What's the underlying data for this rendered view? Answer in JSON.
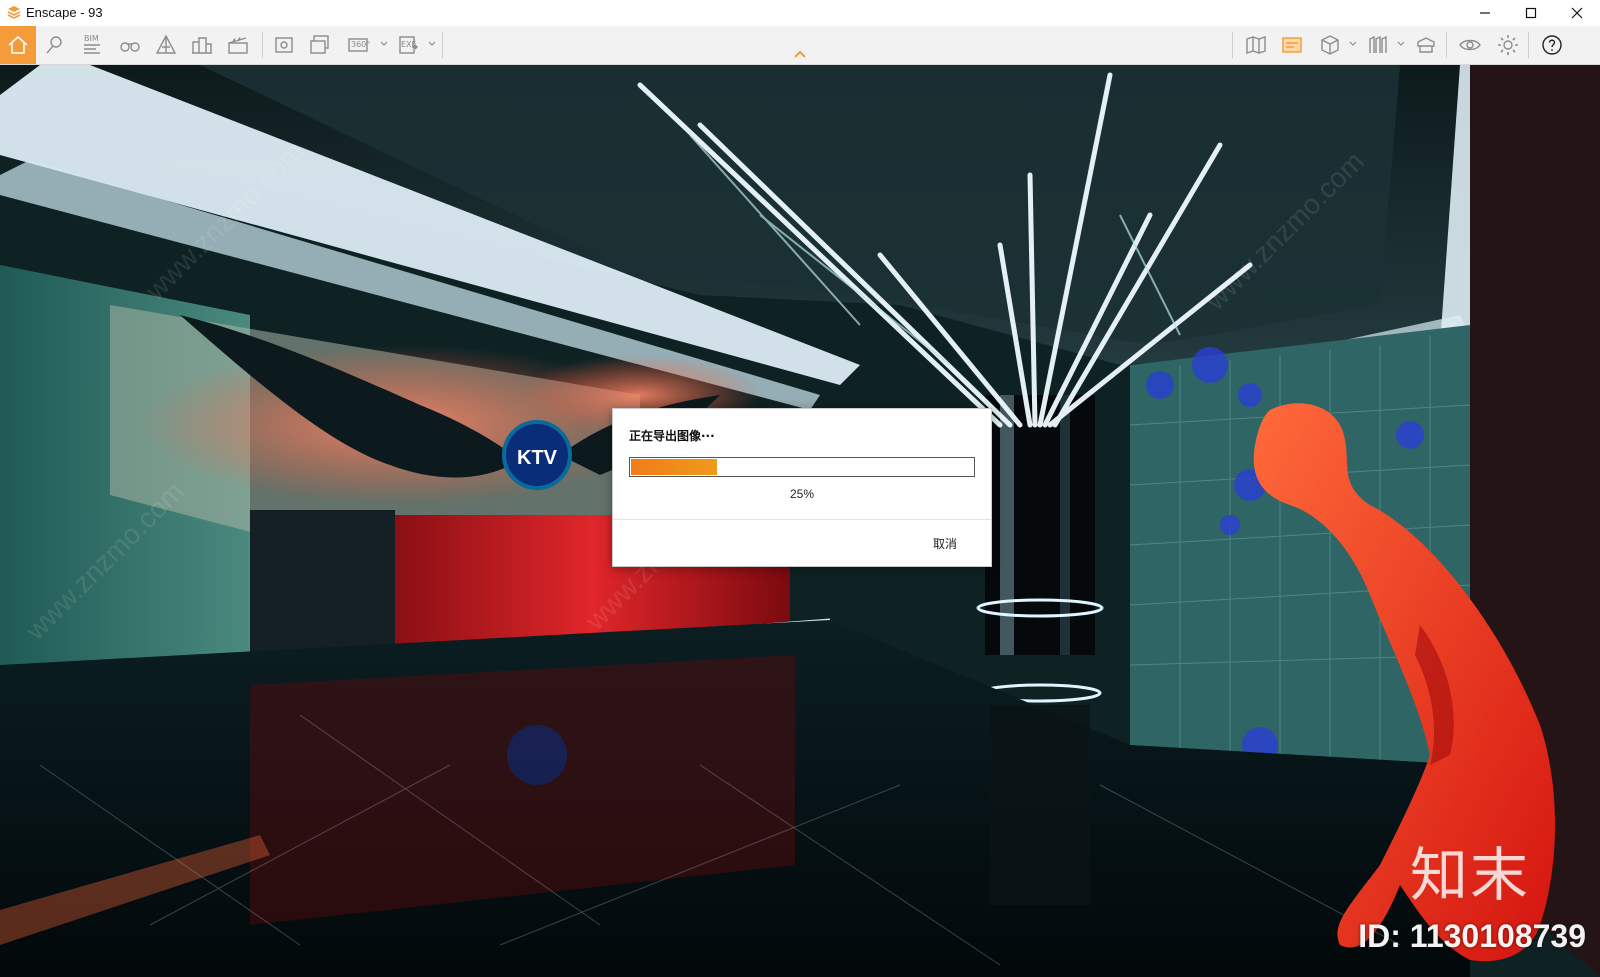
{
  "window": {
    "title": "Enscape - 93",
    "controls": [
      "minimize",
      "maximize",
      "close"
    ]
  },
  "toolbar": {
    "left_icons": [
      "home-icon",
      "location-pin-icon",
      "bim-icon",
      "binoculars-icon",
      "perspective-icon",
      "buildings-icon",
      "clapperboard-icon",
      "screenshot-icon",
      "batch-render-icon",
      "panorama-icon",
      "export-exe-icon"
    ],
    "bim_label": "BIM",
    "panorama_label": "360°",
    "exe_label": "EXE",
    "right_icons": [
      "map-icon",
      "image-panel-icon",
      "cube-icon",
      "library-icon",
      "asset-library-icon",
      "visibility-icon",
      "settings-icon",
      "help-icon"
    ],
    "accent_color": "#f59b3a"
  },
  "viewport": {
    "sign_text": "KTV"
  },
  "dialog": {
    "title": "正在导出图像···",
    "progress": 25,
    "progress_text": "25%",
    "cancel_label": "取消"
  },
  "watermark": {
    "brand": "知末",
    "id_text": "ID: 1130108739",
    "diagonal_text": "www.znzmo.com"
  }
}
